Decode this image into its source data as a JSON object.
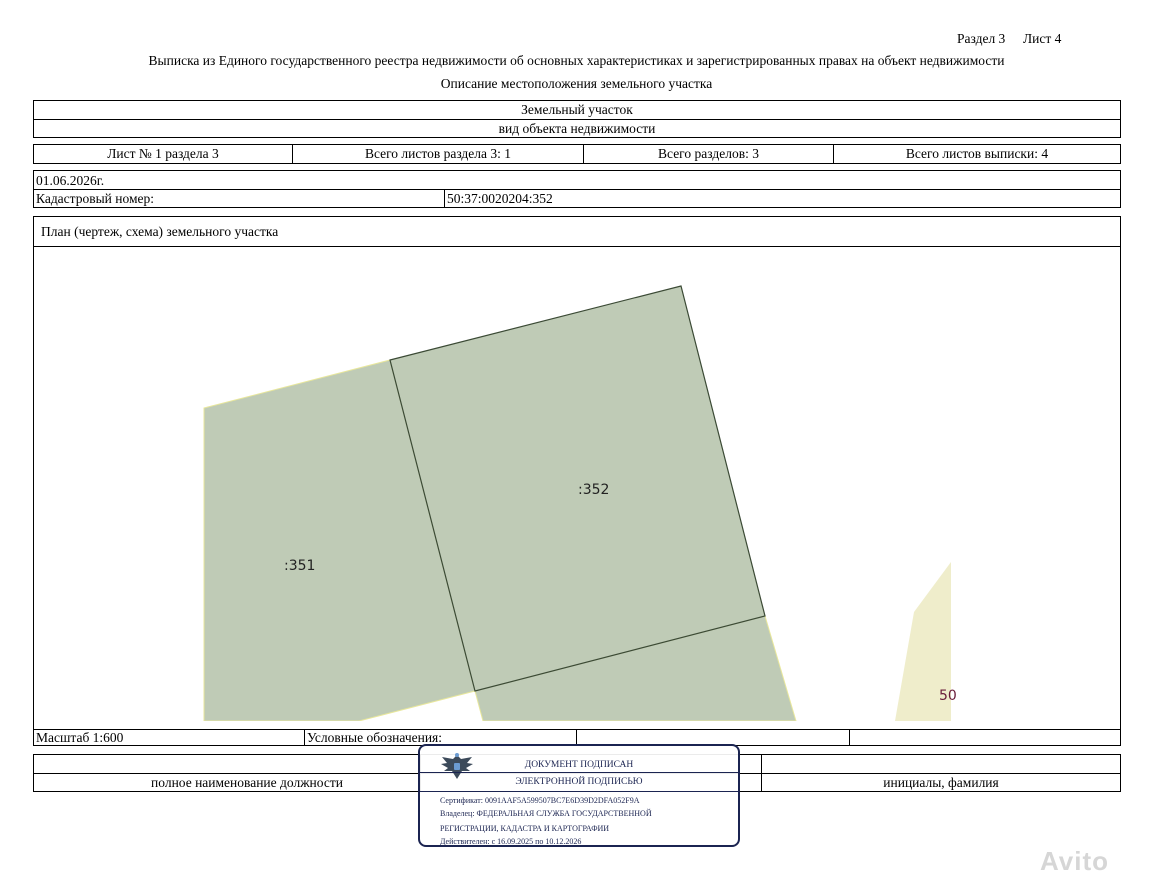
{
  "header": {
    "section": "Раздел 3",
    "sheet": "Лист 4",
    "title": "Выписка из Единого государственного реестра недвижимости об основных характеристиках и зарегистрированных правах на объект недвижимости",
    "subtitle": "Описание местоположения земельного участка"
  },
  "object": {
    "name": "Земельный участок",
    "kind_caption": "вид объекта недвижимости"
  },
  "sheets": {
    "sheet_of_section": "Лист № 1 раздела 3",
    "total_section_sheets": "Всего листов раздела 3: 1",
    "total_sections": "Всего разделов: 3",
    "total_extract_sheets": "Всего листов выписки: 4"
  },
  "info": {
    "date": "01.06.2026г.",
    "cadastral_label": "Кадастровый номер:",
    "cadastral_value": "50:37:0020204:352"
  },
  "plan": {
    "title": "План (чертеж, схема) земельного участка",
    "labels": {
      "p351": ":351",
      "p352": ":352",
      "partial": "50"
    },
    "colors": {
      "parcel_fill": "#bfcbb6",
      "parcel_stroke": "#3b4a35",
      "neighbor_fill": "#efedcb"
    }
  },
  "footer": {
    "scale": "Масштаб 1:600",
    "legend": "Условные обозначения:",
    "position_caption": "полное наименование должности",
    "name_caption": "инициалы, фамилия"
  },
  "stamp": {
    "line1": "ДОКУМЕНТ ПОДПИСАН",
    "line2": "ЭЛЕКТРОННОЙ ПОДПИСЬЮ",
    "cert": "Сертификат: 0091AAF5A599507BC7E6D39D2DFA052F9A",
    "owner1": "Владелец: ФЕДЕРАЛЬНАЯ СЛУЖБА ГОСУДАРСТВЕННОЙ",
    "owner2": "РЕГИСТРАЦИИ, КАДАСТРА И КАРТОГРАФИИ",
    "valid": "Действителен: с 16.09.2025 по 10.12.2026",
    "emblem_icon": "eagle-emblem-icon"
  },
  "watermark": "Avito"
}
